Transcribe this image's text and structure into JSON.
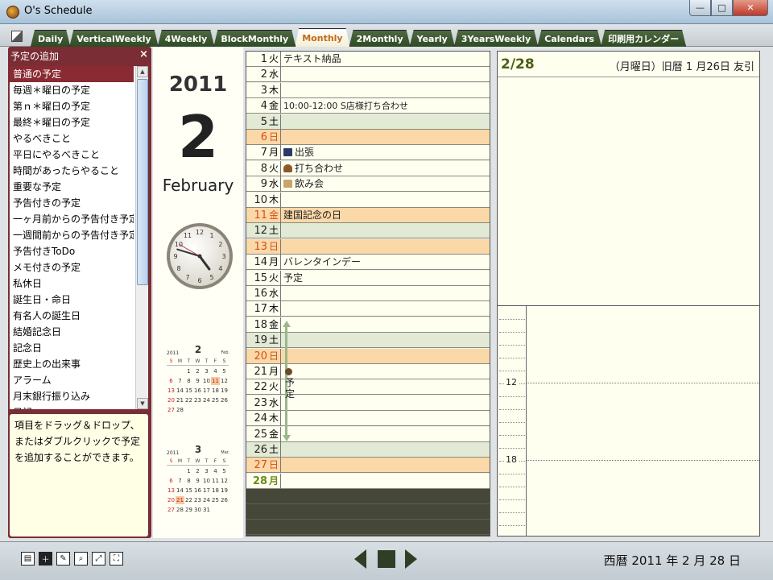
{
  "window": {
    "title": "O's Schedule",
    "min": "—",
    "max": "□",
    "close": "✕"
  },
  "tabs": [
    {
      "label": "Daily"
    },
    {
      "label": "VerticalWeekly"
    },
    {
      "label": "4Weekly"
    },
    {
      "label": "BlockMonthly"
    },
    {
      "label": "Monthly",
      "active": true
    },
    {
      "label": "2Monthly"
    },
    {
      "label": "Yearly"
    },
    {
      "label": "3YearsWeekly"
    },
    {
      "label": "Calendars"
    },
    {
      "label": "印刷用カレンダー"
    }
  ],
  "left_panel": {
    "title": "予定の追加",
    "close": "×",
    "items": [
      "普通の予定",
      "毎週＊曜日の予定",
      "第ｎ＊曜日の予定",
      "最終＊曜日の予定",
      "やるべきこと",
      "平日にやるべきこと",
      "時間があったらやること",
      "重要な予定",
      "予告付きの予定",
      "一ヶ月前からの予告付き予定",
      "一週間前からの予告付き予定",
      "予告付きToDo",
      "メモ付きの予定",
      "私休日",
      "誕生日・命日",
      "有名人の誕生日",
      "結婚記念日",
      "記念日",
      "歴史上の出来事",
      "アラーム",
      "月末銀行振り込み",
      "日記"
    ],
    "help": "項目をドラッグ＆ドロップ、またはダブルクリックで予定を追加することができます。"
  },
  "header": {
    "year": "2011",
    "month_number": "2",
    "month_name": "February"
  },
  "clock": {
    "hour": 4,
    "minute": 47,
    "second": 50
  },
  "mini_calendars": [
    {
      "year": "2011",
      "month": "2",
      "en": "Feb.",
      "weekdays": [
        "S",
        "M",
        "T",
        "W",
        "T",
        "F",
        "S"
      ],
      "start": 2,
      "days": 28,
      "holidays": [
        11
      ]
    },
    {
      "year": "2011",
      "month": "3",
      "en": "Mar.",
      "weekdays": [
        "S",
        "M",
        "T",
        "W",
        "T",
        "F",
        "S"
      ],
      "start": 2,
      "days": 31,
      "holidays": [
        21
      ]
    }
  ],
  "month_days": [
    {
      "d": "1",
      "w": "火",
      "t": "",
      "ev": "テキスト納品"
    },
    {
      "d": "2",
      "w": "水",
      "t": "",
      "ev": ""
    },
    {
      "d": "3",
      "w": "木",
      "t": "",
      "ev": ""
    },
    {
      "d": "4",
      "w": "金",
      "t": "",
      "ev": "10:00-12:00 S店様打ち合わせ"
    },
    {
      "d": "5",
      "w": "土",
      "t": "sat",
      "ev": ""
    },
    {
      "d": "6",
      "w": "日",
      "t": "sun",
      "ev": ""
    },
    {
      "d": "7",
      "w": "月",
      "t": "",
      "ev": "出張",
      "icon": "bag"
    },
    {
      "d": "8",
      "w": "火",
      "t": "",
      "ev": "打ち合わせ",
      "icon": "person"
    },
    {
      "d": "9",
      "w": "水",
      "t": "",
      "ev": "飲み会",
      "icon": "drink"
    },
    {
      "d": "10",
      "w": "木",
      "t": "",
      "ev": ""
    },
    {
      "d": "11",
      "w": "金",
      "t": "hol",
      "ev": "建国記念の日"
    },
    {
      "d": "12",
      "w": "土",
      "t": "sat",
      "ev": ""
    },
    {
      "d": "13",
      "w": "日",
      "t": "sun",
      "ev": ""
    },
    {
      "d": "14",
      "w": "月",
      "t": "",
      "ev": "バレンタインデー"
    },
    {
      "d": "15",
      "w": "火",
      "t": "",
      "ev": "予定"
    },
    {
      "d": "16",
      "w": "水",
      "t": "",
      "ev": ""
    },
    {
      "d": "17",
      "w": "木",
      "t": "",
      "ev": ""
    },
    {
      "d": "18",
      "w": "金",
      "t": "",
      "ev": ""
    },
    {
      "d": "19",
      "w": "土",
      "t": "sat",
      "ev": ""
    },
    {
      "d": "20",
      "w": "日",
      "t": "sun",
      "ev": ""
    },
    {
      "d": "21",
      "w": "月",
      "t": "",
      "ev": ""
    },
    {
      "d": "22",
      "w": "火",
      "t": "",
      "ev": ""
    },
    {
      "d": "23",
      "w": "水",
      "t": "",
      "ev": ""
    },
    {
      "d": "24",
      "w": "木",
      "t": "",
      "ev": ""
    },
    {
      "d": "25",
      "w": "金",
      "t": "",
      "ev": ""
    },
    {
      "d": "26",
      "w": "土",
      "t": "sat",
      "ev": ""
    },
    {
      "d": "27",
      "w": "日",
      "t": "sun",
      "ev": ""
    },
    {
      "d": "28",
      "w": "月",
      "t": "today",
      "ev": ""
    }
  ],
  "multi_day_event": {
    "label": "予定"
  },
  "day_detail": {
    "date": "2/28",
    "info": "（月曜日）旧暦 1 月26日 友引",
    "hours": [
      "12",
      "18"
    ]
  },
  "status": {
    "date": "西暦  2011 年   2 月 28 日"
  },
  "colors": {
    "accent": "#7a2d34",
    "tab_active_text": "#c46a17",
    "holiday": "#d4501a",
    "saturday_bg": "#e2ead6",
    "sunday_bg": "#fbd8a8"
  }
}
